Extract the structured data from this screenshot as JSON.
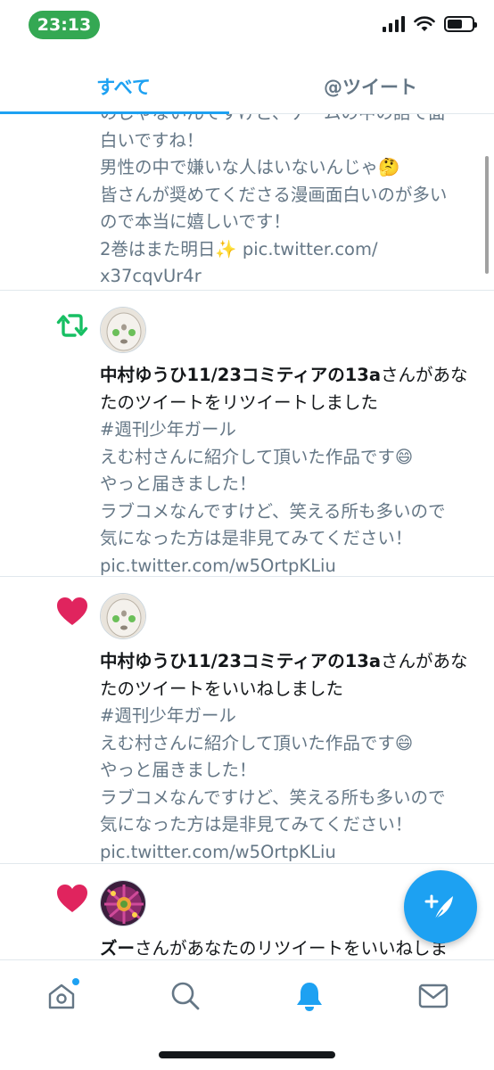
{
  "status_bar": {
    "time": "23:13",
    "battery_level": 0.6
  },
  "tabs": [
    {
      "label": "すべて",
      "active": true
    },
    {
      "label": "@ツイート",
      "active": false
    }
  ],
  "feed": {
    "partial_top": {
      "lines": "のじゃないんですけど、ゲームの中の話で面\n白いですね！\n男性の中で嫌いな人はいないんじゃ🤔\n皆さんが奨めてくださる漫画面白いのが多い\nので本当に嬉しいです！\n2巻はまた明日✨ pic.twitter.com/\nx37cqvUr4r"
    },
    "items": [
      {
        "type": "retweet",
        "icon": "retweet-icon",
        "user": "中村ゆうひ11/23コミティアの13a",
        "action": "さんがあなたのツイートをリツイートしました",
        "body": "#週刊少年ガール\nえむ村さんに紹介して頂いた作品です😄\nやっと届きました！\nラブコメなんですけど、笑える所も多いので\n気になった方は是非見てみてください！\npic.twitter.com/w5OrtpKLiu"
      },
      {
        "type": "like",
        "icon": "heart-icon",
        "user": "中村ゆうひ11/23コミティアの13a",
        "action": "さんがあなたのツイートをいいねしました",
        "body": "#週刊少年ガール\nえむ村さんに紹介して頂いた作品です😄\nやっと届きました！\nラブコメなんですけど、笑える所も多いので\n気になった方は是非見てみてください！\npic.twitter.com/w5OrtpKLiu"
      },
      {
        "type": "like",
        "icon": "heart-icon",
        "user": "ズー",
        "action": "さんがあなたのリツイートをいいねしま",
        "body": ""
      }
    ]
  },
  "fab": {
    "icon": "compose-feather-icon"
  },
  "bottom_nav": [
    {
      "name": "home",
      "icon": "home-icon",
      "active": false,
      "badge": true
    },
    {
      "name": "search",
      "icon": "search-icon",
      "active": false
    },
    {
      "name": "notifications",
      "icon": "bell-icon",
      "active": true
    },
    {
      "name": "messages",
      "icon": "mail-icon",
      "active": false
    }
  ],
  "colors": {
    "accent": "#1da1f2",
    "retweet": "#17bf63",
    "like": "#e0245e",
    "secondary_text": "#657786"
  }
}
